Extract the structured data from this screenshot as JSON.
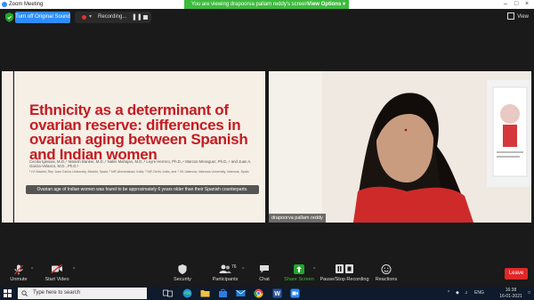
{
  "window": {
    "title": "Zoom Meeting"
  },
  "share_banner": {
    "text": "You are viewing drapoorva pallam reddy's screen",
    "options_label": "View Options"
  },
  "meeting_bar": {
    "original_sound_label": "Turn off Original Sound",
    "recording_label": "Recording...",
    "view_label": "View"
  },
  "slide": {
    "title": "Ethnicity as a determinant of ovarian reserve: differences in ovarian aging between Spanish and Indian women",
    "authors": "Cecilia Iglesias, M.D.,¹ Manish Banker, M.D.,² Nalini Mahajan, M.D.,³ Leyre Herrero, Ph.D.,⁴ Marcos Meseguer, Ph.D.,⁴ and Juan A. Garcia-Velasco, M.D., Ph.D.¹",
    "affiliations": "¹ IVI Madrid, Rey Juan Carlos University, Madrid, Spain; ² NIF-Ahmedabad, India; ³ NIF-Delhi, India; and ⁴ IVI-Valencia, Valencia University, Valencia, Spain",
    "banner": "Ovarian age of Indian women was found to be approximately 6 years older than their Spanish counterparts."
  },
  "video": {
    "participant_name": "drapoorva pallam reddy"
  },
  "toolbar": {
    "unmute": "Unmute",
    "start_video": "Start Video",
    "security": "Security",
    "participants": "Participants",
    "participants_count": "76",
    "chat": "Chat",
    "share_screen": "Share Screen",
    "pause_recording": "Pause/Stop Recording",
    "reactions": "Reactions",
    "leave": "Leave"
  },
  "taskbar": {
    "search_placeholder": "Type here to search",
    "language": "ENG",
    "time": "16:38",
    "date": "16-01-2021"
  },
  "colors": {
    "slide_title": "#c41c22",
    "zoom_blue": "#2d8cff",
    "share_green": "#3dbb3d",
    "leave_red": "#e02828"
  }
}
